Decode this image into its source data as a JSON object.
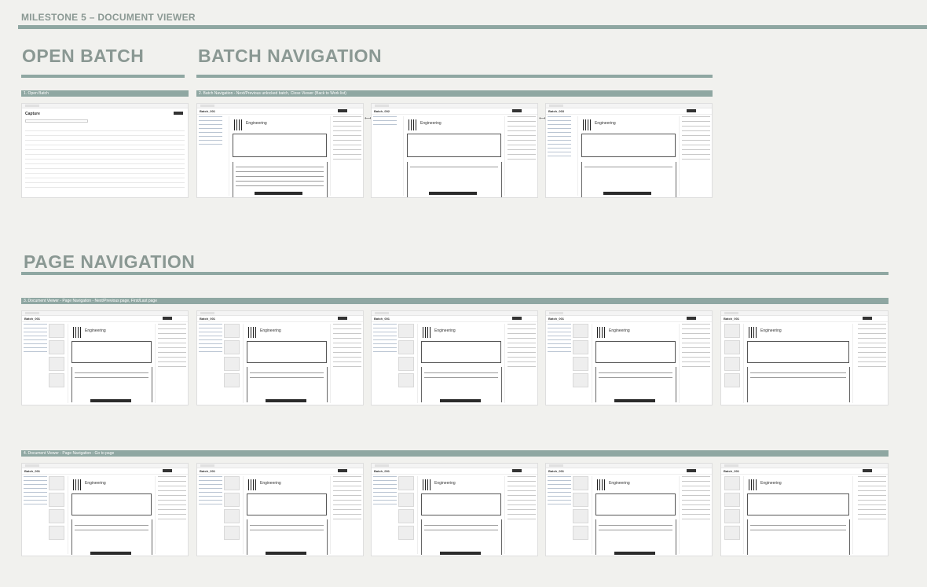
{
  "header": {
    "title": "MILESTONE 5 – DOCUMENT VIEWER"
  },
  "sections": {
    "open_batch": {
      "title": "OPEN BATCH",
      "label": "1. Open Batch"
    },
    "batch_navigation": {
      "title": "BATCH NAVIGATION",
      "label": "2. Batch Navigation - Next/Previous unlocked batch, Close Viewer (Back to Work list)"
    },
    "page_navigation": {
      "title": "PAGE NAVIGATION",
      "row1_label": "3. Document Viewer - Page Navigation - Next/Previous page, First/Last page",
      "row2_label": "4. Document Viewer - Page Navigation - Go to page"
    }
  },
  "thumbnails": {
    "open_batch_title": "Capture",
    "brand": "Engineering",
    "batch_titles": [
      "Batch_001",
      "Batch_002",
      "Batch_003"
    ],
    "page_nav_title": "Batch_001"
  },
  "colors": {
    "accent": "#8fa7a2",
    "heading": "#8a9893"
  }
}
